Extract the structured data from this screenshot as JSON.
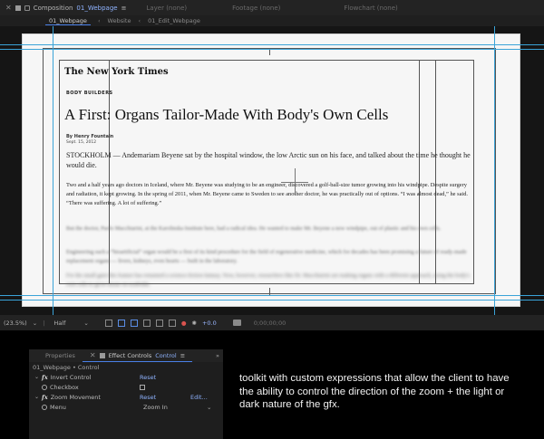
{
  "tabbar": {
    "composition_label": "Composition",
    "composition_name": "01_Webpage",
    "layer_tab": "Layer (none)",
    "footage_tab": "Footage (none)",
    "flowchart_tab": "Flowchart (none)"
  },
  "breadcrumbs": [
    "01_Webpage",
    "Website",
    "01_Edit_Webpage"
  ],
  "article": {
    "masthead": "The New York Times",
    "section": "BODY BUILDERS",
    "headline": "A First: Organs Tailor-Made With Body's Own Cells",
    "byline": "By Henry Fountain",
    "date": "Sept. 15, 2012",
    "p1": "STOCKHOLM — Andemariam Beyene sat by the hospital window, the low Arctic sun on his face, and talked about the time he thought he would die.",
    "p2": "Two and a half years ago doctors in Iceland, where Mr. Beyene was studying to be an engineer, discovered a golf-ball-size tumor growing into his windpipe. Despite surgery and radiation, it kept growing. In the spring of 2011, when Mr. Beyene came to Sweden to see another doctor, he was practically out of options. “I was almost dead,” he said. “There was suffering. A lot of suffering.”",
    "p3": "But the doctor, Paolo Macchiarini, at the Karolinska Institute here, had a radical idea. He wanted to make Mr. Beyene a new windpipe, out of plastic and his own cells.",
    "p4": "Engineering such a “bioartificial” organ would be a first of its kind procedure for the field of regenerative medicine, which for decades has been promising a future of ready-made replacement organs — livers, kidneys, even hearts — built in the laboratory.",
    "p5": "For the small gain this feature has remained a science-fiction fantasy. Now, however, researchers like Dr. Macchiarini are making organs with a different approach, using the body's own cells to grow tissue on scaffolds."
  },
  "statusbar": {
    "zoom": "(23.5%)",
    "resolution": "Half",
    "exposure": "+0.0",
    "timecode": "0;00;00;00"
  },
  "fxpanel": {
    "tab_properties": "Properties",
    "tab_effect_controls": "Effect Controls",
    "tab_effect_target": "Control",
    "title": "01_Webpage • Control",
    "rows": [
      {
        "label": "Invert Control",
        "reset": "Reset"
      },
      {
        "label": "Checkbox"
      },
      {
        "label": "Zoom Movement",
        "reset": "Reset",
        "edit": "Edit..."
      },
      {
        "label": "Menu",
        "value": "Zoom In"
      }
    ]
  },
  "caption": "toolkit with custom expressions that allow the client to have the ability to control the direction of the zoom + the light or dark nature of the gfx.",
  "colors": {
    "guide": "#3aa3d8",
    "accent_blue": "#8fb3ff",
    "tab_underline": "#4a80e8"
  }
}
